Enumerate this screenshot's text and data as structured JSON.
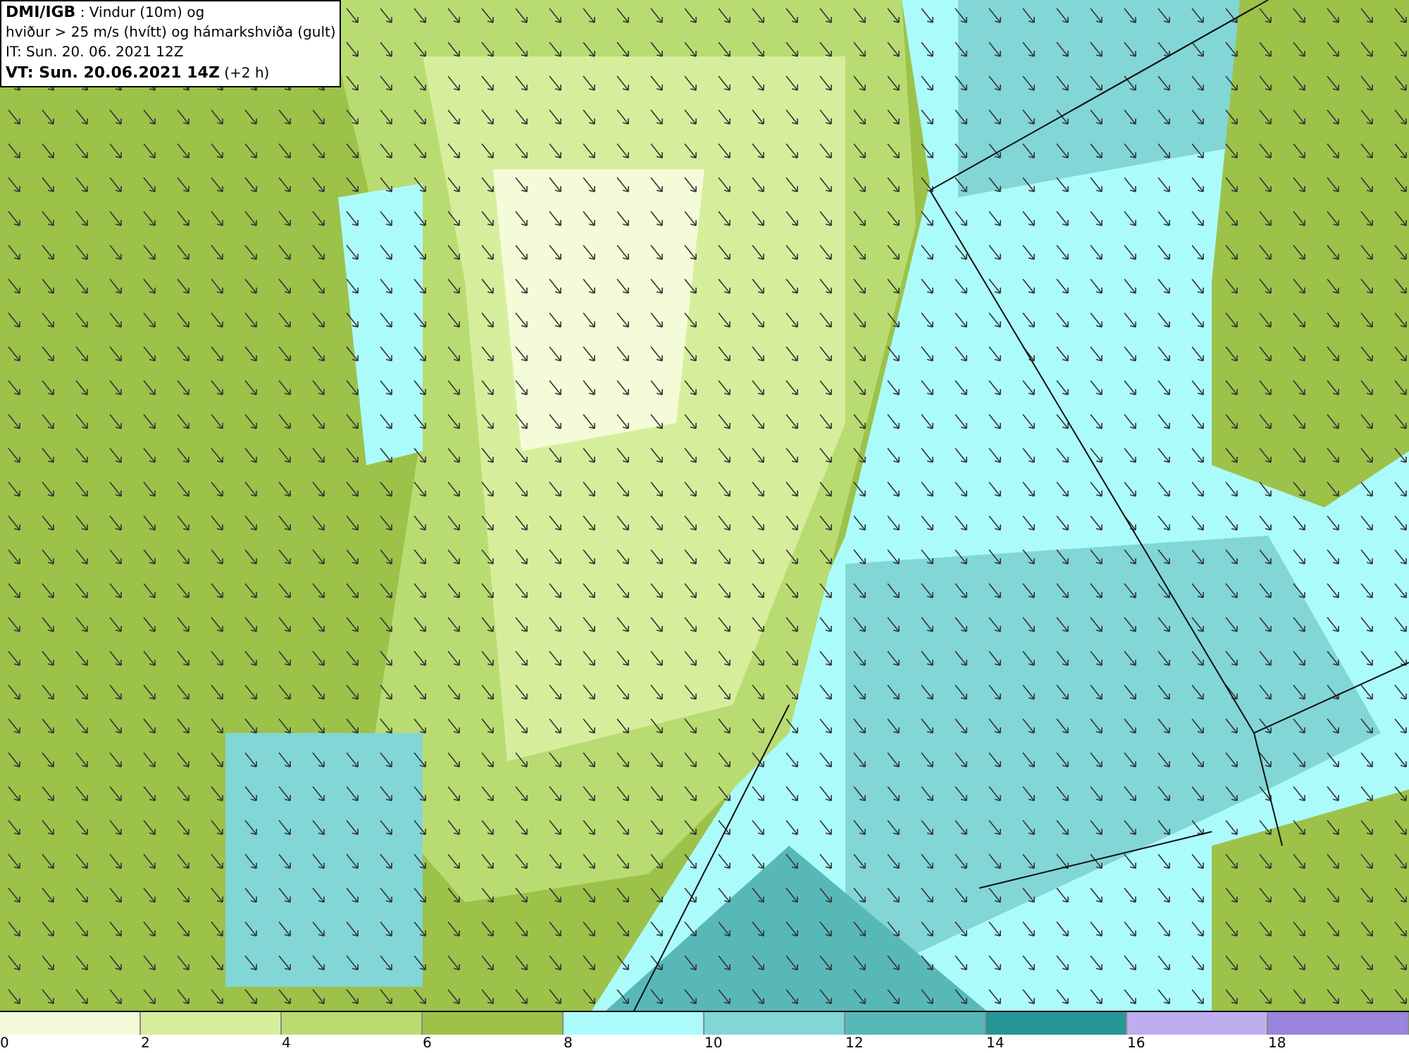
{
  "title_box": {
    "lines": [
      "**DMI/IGB** : Vindur (10m) og",
      "hviður > 25 m/s (hvítt) og hámarkshviða (gult)",
      "IT: Sun. 20. 06. 2021 12Z",
      "**VT: Sun. 20.06.2021 14Z** (+2 h)"
    ]
  },
  "legend": {
    "bins": [
      {
        "color": "#f4fbd8"
      },
      {
        "color": "#d6ee9c"
      },
      {
        "color": "#b9dc72"
      },
      {
        "color": "#9cc24a"
      },
      {
        "color": "#acfbfb"
      },
      {
        "color": "#82d6d6"
      },
      {
        "color": "#58b8b8"
      },
      {
        "color": "#269696"
      },
      {
        "color": "#beaef0"
      },
      {
        "color": "#9a84dc"
      }
    ],
    "labels": [
      "0",
      "2",
      "4",
      "6",
      "8",
      "10",
      "12",
      "14",
      "16",
      "18"
    ]
  }
}
